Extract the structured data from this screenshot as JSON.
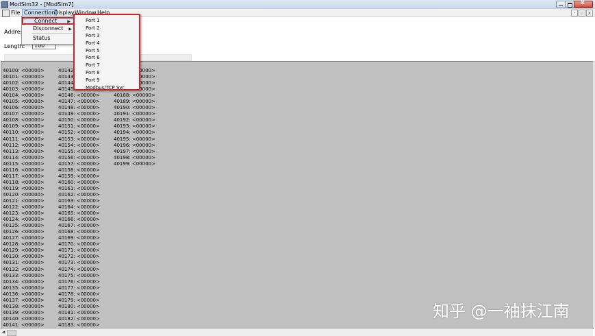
{
  "window": {
    "title": "ModSim32 - [ModSim7]"
  },
  "menubar": {
    "items": [
      "File",
      "Connection",
      "Display",
      "Window",
      "Help"
    ]
  },
  "form": {
    "address_label": "Address",
    "length_label": "Length:",
    "length_value": "100"
  },
  "connection_menu": {
    "items": [
      "Connect",
      "Disconnect",
      "Status"
    ]
  },
  "port_submenu": {
    "items": [
      "Port 1",
      "Port 2",
      "Port 3",
      "Port 4",
      "Port 5",
      "Port 6",
      "Port 7",
      "Port 8",
      "Port 9",
      "Modbus/TCP Svr"
    ]
  },
  "registers": {
    "value": "<00000>",
    "columns": [
      {
        "start": 40100,
        "count": 42
      },
      {
        "start": 40142,
        "count": 42
      },
      {
        "start": 40184,
        "count": 16
      }
    ]
  },
  "watermark": "知乎 @一袖抹江南"
}
